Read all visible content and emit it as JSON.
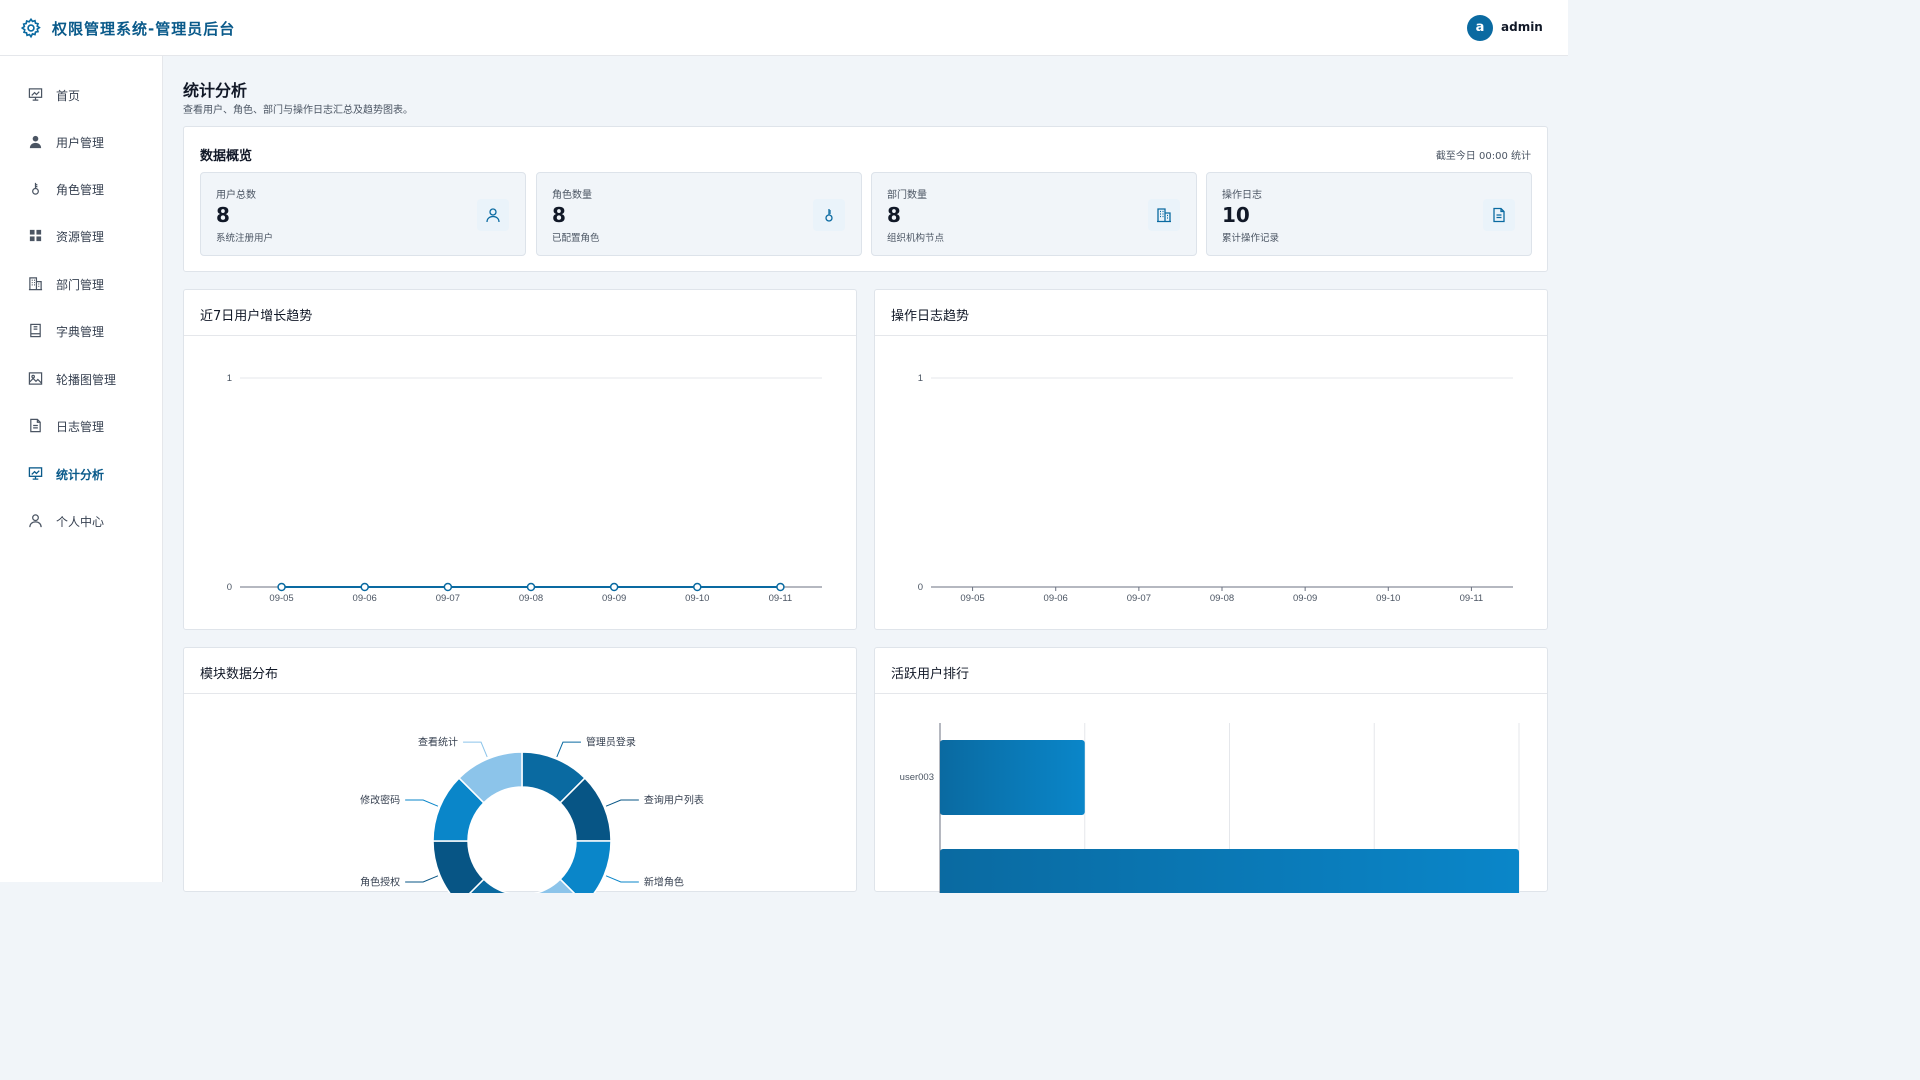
{
  "header": {
    "app_title": "权限管理系统-管理员后台",
    "avatar_letter": "a",
    "username": "admin",
    "brand_color": "#0a6aa1"
  },
  "sidebar": {
    "items": [
      {
        "label": "首页",
        "icon": "presentation-chart-icon",
        "active": false
      },
      {
        "label": "用户管理",
        "icon": "user-icon",
        "active": false
      },
      {
        "label": "角色管理",
        "icon": "role-key-icon",
        "active": false
      },
      {
        "label": "资源管理",
        "icon": "grid-icon",
        "active": false
      },
      {
        "label": "部门管理",
        "icon": "building-icon",
        "active": false
      },
      {
        "label": "字典管理",
        "icon": "book-icon",
        "active": false
      },
      {
        "label": "轮播图管理",
        "icon": "image-icon",
        "active": false
      },
      {
        "label": "日志管理",
        "icon": "document-icon",
        "active": false
      },
      {
        "label": "统计分析",
        "icon": "presentation-chart-icon",
        "active": true
      },
      {
        "label": "个人中心",
        "icon": "user-outline-icon",
        "active": false
      }
    ]
  },
  "main": {
    "title": "统计分析",
    "subtitle": "查看用户、角色、部门与操作日志汇总及趋势图表。",
    "overview": {
      "title": "数据概览",
      "note": "截至今日 00:00 统计",
      "stats": [
        {
          "label": "用户总数",
          "value": "8",
          "desc": "系统注册用户",
          "icon": "user-icon"
        },
        {
          "label": "角色数量",
          "value": "8",
          "desc": "已配置角色",
          "icon": "role-key-icon"
        },
        {
          "label": "部门数量",
          "value": "8",
          "desc": "组织机构节点",
          "icon": "building-icon"
        },
        {
          "label": "操作日志",
          "value": "10",
          "desc": "累计操作记录",
          "icon": "document-icon"
        }
      ]
    },
    "panels": {
      "user_growth": "近7日用户增长趋势",
      "log_trend": "操作日志趋势",
      "module_dist": "模块数据分布",
      "active_users": "活跃用户排行"
    }
  },
  "chart_data": [
    {
      "type": "line",
      "title": "近7日用户增长趋势",
      "x": [
        "09-05",
        "09-06",
        "09-07",
        "09-08",
        "09-09",
        "09-10",
        "09-11"
      ],
      "series": [
        {
          "values": [
            0,
            0,
            0,
            0,
            0,
            0,
            0
          ]
        }
      ],
      "yticks": [
        "0",
        "1"
      ],
      "ylim": [
        0,
        1
      ],
      "grid": true,
      "color": "#0a6aa1"
    },
    {
      "type": "line",
      "title": "操作日志趋势",
      "x": [
        "09-05",
        "09-06",
        "09-07",
        "09-08",
        "09-09",
        "09-10",
        "09-11"
      ],
      "series": [],
      "yticks": [
        "0",
        "1"
      ],
      "ylim": [
        0,
        1
      ],
      "grid": true
    },
    {
      "type": "pie",
      "title": "模块数据分布",
      "donut": true,
      "labels": [
        "管理员登录",
        "查询用户列表",
        "新增角色",
        "查看统计",
        "修改密码",
        "角色授权"
      ],
      "slices": [
        {
          "label": "管理员登录",
          "value": 1,
          "color": "#0a6aa1"
        },
        {
          "label": "查询用户列表",
          "value": 1,
          "color": "#075585"
        },
        {
          "label": "新增角色",
          "value": 1,
          "color": "#0a86c9"
        },
        {
          "label": null,
          "value": 1,
          "color": "#8cc4ea"
        },
        {
          "label": null,
          "value": 1,
          "color": "#0a6aa1"
        },
        {
          "label": "角色授权",
          "value": 1,
          "color": "#075585"
        },
        {
          "label": "修改密码",
          "value": 1,
          "color": "#0a86c9"
        },
        {
          "label": "查看统计",
          "value": 1,
          "color": "#8cc4ea"
        }
      ]
    },
    {
      "type": "bar",
      "orientation": "horizontal",
      "title": "活跃用户排行",
      "categories": [
        "user003",
        ""
      ],
      "values": [
        1,
        4
      ],
      "xlim": [
        0,
        4
      ],
      "grid": true,
      "color": "#0a6aa1"
    }
  ]
}
